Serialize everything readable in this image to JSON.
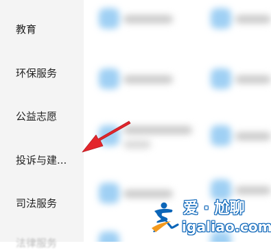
{
  "sidebar": {
    "items": [
      {
        "label": "教育"
      },
      {
        "label": "环保服务"
      },
      {
        "label": "公益志愿"
      },
      {
        "label": "投诉与建..."
      },
      {
        "label": "司法服务"
      },
      {
        "label": "法律服务"
      }
    ]
  },
  "watermark": {
    "brand": "爱 · 尬聊",
    "domain": "igaliao.com"
  },
  "colors": {
    "arrow": "#e3262c",
    "sidebar_bg": "#f4f4f4",
    "icon_blob": "#9fd0f4",
    "watermark_blue": "#0b65b8",
    "watermark_orange": "#f39a1f"
  }
}
